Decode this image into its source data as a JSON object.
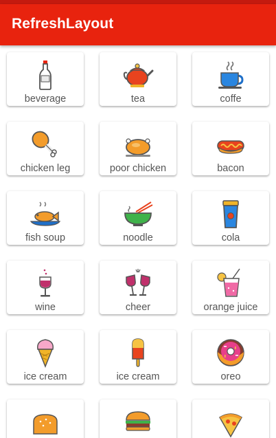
{
  "app_bar": {
    "title": "RefreshLayout"
  },
  "colors": {
    "primary": "#e8230e",
    "primary_dark": "#c41a0f"
  },
  "items": [
    {
      "label": "beverage",
      "icon": "bottle-icon"
    },
    {
      "label": "tea",
      "icon": "teapot-icon"
    },
    {
      "label": "coffe",
      "icon": "coffee-cup-icon"
    },
    {
      "label": "chicken leg",
      "icon": "chicken-leg-icon"
    },
    {
      "label": "poor chicken",
      "icon": "roast-chicken-icon"
    },
    {
      "label": "bacon",
      "icon": "hotdog-icon"
    },
    {
      "label": "fish soup",
      "icon": "fish-dish-icon"
    },
    {
      "label": "noodle",
      "icon": "noodle-bowl-icon"
    },
    {
      "label": "cola",
      "icon": "cola-cup-icon"
    },
    {
      "label": "wine",
      "icon": "wine-glass-icon"
    },
    {
      "label": "cheer",
      "icon": "cheers-glasses-icon"
    },
    {
      "label": "orange juice",
      "icon": "juice-glass-icon"
    },
    {
      "label": "ice cream",
      "icon": "ice-cream-cone-icon"
    },
    {
      "label": "ice cream",
      "icon": "popsicle-icon"
    },
    {
      "label": "oreo",
      "icon": "donut-icon"
    },
    {
      "label": "",
      "icon": "bread-icon"
    },
    {
      "label": "",
      "icon": "burger-icon"
    },
    {
      "label": "",
      "icon": "pizza-slice-icon"
    }
  ]
}
